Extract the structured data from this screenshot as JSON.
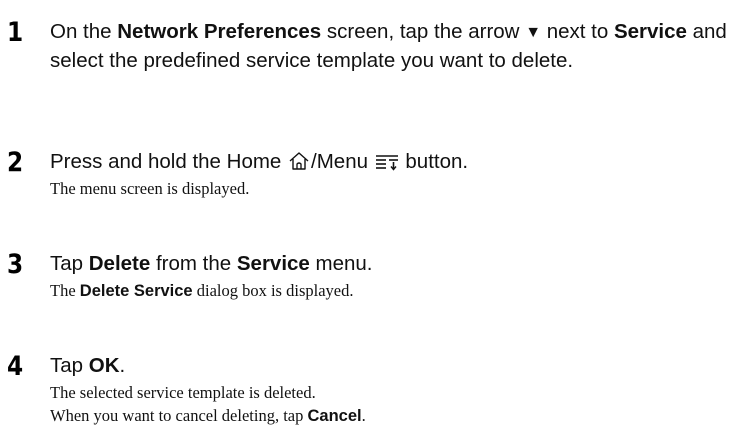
{
  "steps": [
    {
      "number": "1",
      "text": {
        "a": "On the ",
        "b": "Network Preferences",
        "c": " screen, tap the arrow ",
        "arrow": "▼",
        "d": " next to ",
        "e": "Service",
        "f": " and select the predefined service template you want to delete."
      }
    },
    {
      "number": "2",
      "text": {
        "a": "Press and hold the Home ",
        "home_icon": "home-icon",
        "b": "/Menu ",
        "menu_icon": "menu-icon",
        "c": " button."
      },
      "desc": {
        "line1": "The menu screen is displayed."
      }
    },
    {
      "number": "3",
      "text": {
        "a": "Tap ",
        "b": "Delete",
        "c": " from the ",
        "d": "Service",
        "e": " menu."
      },
      "desc": {
        "a": "The ",
        "b": "Delete Service",
        "c": " dialog box is displayed."
      }
    },
    {
      "number": "4",
      "text": {
        "a": "Tap ",
        "b": "OK",
        "c": "."
      },
      "desc": {
        "line1": "The selected service template is deleted.",
        "line2a": "When you want to cancel deleting, tap ",
        "line2b": "Cancel",
        "line2c": "."
      }
    }
  ]
}
